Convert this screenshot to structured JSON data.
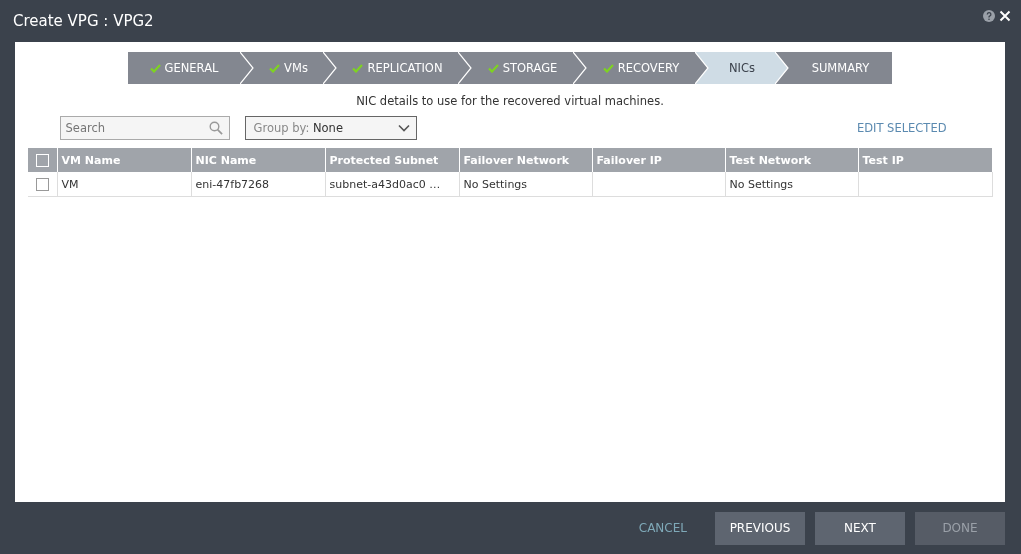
{
  "window": {
    "title": "Create VPG : VPG2"
  },
  "steps": [
    {
      "label": "GENERAL",
      "done": true,
      "selected": false
    },
    {
      "label": "VMs",
      "done": true,
      "selected": false
    },
    {
      "label": "REPLICATION",
      "done": true,
      "selected": false
    },
    {
      "label": "STORAGE",
      "done": true,
      "selected": false
    },
    {
      "label": "RECOVERY",
      "done": true,
      "selected": false
    },
    {
      "label": "NICs",
      "done": false,
      "selected": true
    },
    {
      "label": "SUMMARY",
      "done": false,
      "selected": false
    }
  ],
  "description": "NIC details to use for the recovered virtual machines.",
  "search": {
    "placeholder": "Search"
  },
  "group_by": {
    "label": "Group by:",
    "value": "None"
  },
  "edit_selected": "EDIT SELECTED",
  "table": {
    "all_checked": false,
    "columns": [
      "VM Name",
      "NIC Name",
      "Protected Subnet",
      "Failover Network",
      "Failover IP",
      "Test Network",
      "Test IP"
    ],
    "rows": [
      {
        "checked": false,
        "cells": [
          "VM",
          "eni-47fb7268",
          "subnet-a43d0ac0 …",
          "No Settings",
          "",
          "No Settings",
          ""
        ]
      }
    ]
  },
  "footer": {
    "cancel": "CANCEL",
    "buttons": [
      {
        "label": "PREVIOUS",
        "disabled": false
      },
      {
        "label": "NEXT",
        "disabled": false
      },
      {
        "label": "DONE",
        "disabled": true
      }
    ]
  }
}
